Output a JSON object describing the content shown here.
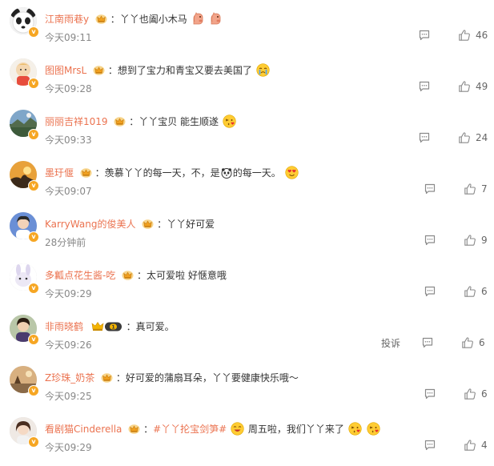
{
  "comments": [
    {
      "user": "江南雨巷y",
      "text": "：丫丫也阖小木马",
      "time": "今天09:11",
      "likes": "46",
      "vip": false,
      "emotes": 2
    },
    {
      "user": "图图MrsL",
      "text": "：想到了宝力和青宝又要去美国了",
      "time": "今天09:28",
      "likes": "49",
      "vip": false,
      "emotes": 1
    },
    {
      "user": "丽丽吉祥1019",
      "text": "：丫丫宝贝 能生顺遂",
      "time": "今天09:33",
      "likes": "24",
      "vip": false,
      "emotes": 1
    },
    {
      "user": "墨玗偃",
      "text": "：羡慕丫丫的每一天，不，是",
      "text2": "的每一天。",
      "time": "今天09:07",
      "likes": "7",
      "vip": false,
      "emotes": 1
    },
    {
      "user": "KarryWang的俊美人",
      "text": "：丫丫好可爱",
      "time": "28分钟前",
      "likes": "9",
      "vip": false,
      "emotes": 0
    },
    {
      "user": "多瓤点花生酱-吃",
      "text": "：太可爱啦 好惬意哦",
      "time": "今天09:29",
      "likes": "6",
      "vip": false,
      "emotes": 0
    },
    {
      "user": "非雨晓鹤",
      "text": "：真可爱。",
      "time": "今天09:26",
      "likes": "6",
      "vip": true,
      "vip_level": "1",
      "report": "投诉",
      "emotes": 0
    },
    {
      "user": "Z珍珠_奶茶",
      "text": "：好可爱的蒲扇耳朵，丫丫要健康快乐哦～",
      "time": "今天09:25",
      "likes": "6",
      "vip": false,
      "emotes": 0
    },
    {
      "user": "看剧猫Cinderella",
      "text_pre": "：",
      "topic": "#丫丫抡宝剑笋#",
      "text": "周五啦，我们丫丫来了",
      "time": "今天09:29",
      "likes": "4",
      "vip": false,
      "emotes": 2
    }
  ],
  "icons": {
    "reply": "comment-icon",
    "like": "thumbs-up-icon",
    "crown": "crown-badge-icon",
    "verified": "verified-badge-icon"
  },
  "colors": {
    "username": "#eb7350",
    "text": "#333333",
    "meta": "#888888"
  }
}
